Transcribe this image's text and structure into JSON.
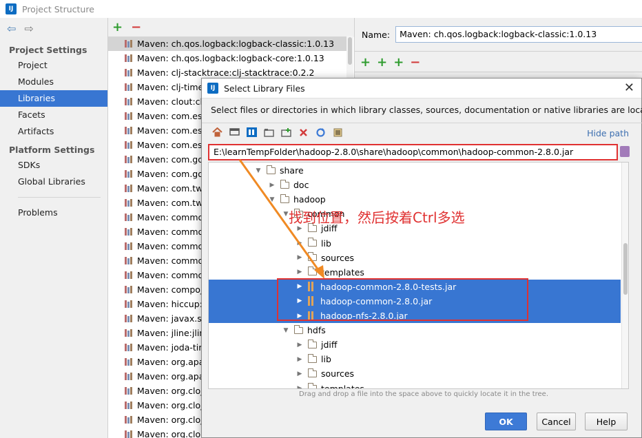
{
  "window": {
    "title": "Project Structure",
    "logo_text": "IJ"
  },
  "nav": {
    "back_glyph": "⇦",
    "forward_glyph": "⇨",
    "project_settings_header": "Project Settings",
    "project_items": [
      "Project",
      "Modules",
      "Libraries",
      "Facets",
      "Artifacts"
    ],
    "platform_settings_header": "Platform Settings",
    "platform_items": [
      "SDKs",
      "Global Libraries"
    ],
    "problems": "Problems",
    "selected_item": "Libraries"
  },
  "libraries": {
    "add_glyph": "+",
    "remove_glyph": "−",
    "items": [
      "Maven: ch.qos.logback:logback-classic:1.0.13",
      "Maven: ch.qos.logback:logback-core:1.0.13",
      "Maven: clj-stacktrace:clj-stacktrace:0.2.2",
      "Maven: clj-time:clj-time:0.8.0",
      "Maven: clout:clout:1.0.1",
      "Maven: com.esotericsoftware",
      "Maven: com.esotericsoftware",
      "Maven: com.esotericsoftware",
      "Maven: com.google.guava",
      "Maven: com.google.code",
      "Maven: com.twitter",
      "Maven: com.twitter",
      "Maven: commons-cli",
      "Maven: commons-codec",
      "Maven: commons-collections",
      "Maven: commons-io",
      "Maven: commons-lang",
      "Maven: compojure",
      "Maven: hiccup:hiccup",
      "Maven: javax.servlet",
      "Maven: jline:jline",
      "Maven: joda-time",
      "Maven: org.apache",
      "Maven: org.apache",
      "Maven: org.clojure",
      "Maven: org.clojure",
      "Maven: org.clojure",
      "Maven: org.clojure"
    ]
  },
  "detail": {
    "name_label": "Name:",
    "name_value": "Maven: ch.qos.logback:logback-classic:1.0.13"
  },
  "dialog": {
    "title": "Select Library Files",
    "close_glyph": "✕",
    "description": "Select files or directories in which library classes, sources, documentation or native libraries are located",
    "hide_path": "Hide path",
    "path": "E:\\learnTempFolder\\hadoop-2.8.0\\share\\hadoop\\common\\hadoop-common-2.8.0.jar",
    "annotation": "找到位置，然后按着Ctrl多选",
    "drag_hint": "Drag and drop a file into the space above to quickly locate it in the tree.",
    "ok": "OK",
    "cancel": "Cancel",
    "help": "Help",
    "tree": [
      {
        "label": "share",
        "depth": 0,
        "type": "folder",
        "expanded": true
      },
      {
        "label": "doc",
        "depth": 1,
        "type": "folder",
        "expanded": false
      },
      {
        "label": "hadoop",
        "depth": 1,
        "type": "folder",
        "expanded": true
      },
      {
        "label": "common",
        "depth": 2,
        "type": "folder",
        "expanded": true
      },
      {
        "label": "jdiff",
        "depth": 3,
        "type": "folder",
        "expanded": false
      },
      {
        "label": "lib",
        "depth": 3,
        "type": "folder",
        "expanded": false
      },
      {
        "label": "sources",
        "depth": 3,
        "type": "folder",
        "expanded": false
      },
      {
        "label": "templates",
        "depth": 3,
        "type": "folder",
        "expanded": false
      },
      {
        "label": "hadoop-common-2.8.0-tests.jar",
        "depth": 3,
        "type": "jar",
        "selected": true
      },
      {
        "label": "hadoop-common-2.8.0.jar",
        "depth": 3,
        "type": "jar",
        "selected": true
      },
      {
        "label": "hadoop-nfs-2.8.0.jar",
        "depth": 3,
        "type": "jar",
        "selected": true
      },
      {
        "label": "hdfs",
        "depth": 2,
        "type": "folder",
        "expanded": true
      },
      {
        "label": "jdiff",
        "depth": 3,
        "type": "folder",
        "expanded": false
      },
      {
        "label": "lib",
        "depth": 3,
        "type": "folder",
        "expanded": false
      },
      {
        "label": "sources",
        "depth": 3,
        "type": "folder",
        "expanded": false
      },
      {
        "label": "templates",
        "depth": 3,
        "type": "folder",
        "expanded": false
      }
    ]
  },
  "colors": {
    "selection": "#3876d2",
    "annotation": "#e03131",
    "link": "#3d6fb0"
  }
}
